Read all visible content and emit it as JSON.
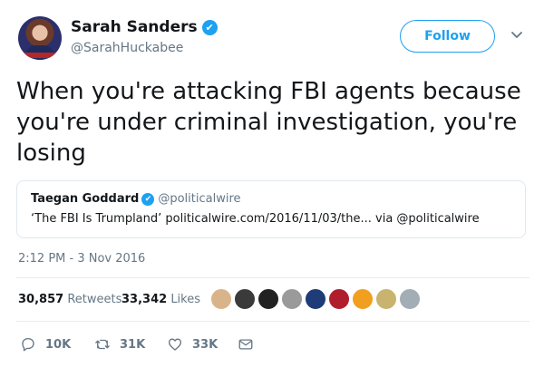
{
  "author": {
    "name": "Sarah Sanders",
    "handle": "@SarahHuckabee",
    "verified_glyph": "✔"
  },
  "follow_button": {
    "label": "Follow"
  },
  "tweet": {
    "text": "When you're attacking FBI agents because you're under criminal investigation, you're losing"
  },
  "quoted_tweet": {
    "author_name": "Taegan Goddard",
    "author_handle": "@politicalwire",
    "text": "‘The FBI Is Trumpland’ politicalwire.com/2016/11/03/the... via @politicalwire"
  },
  "timestamp": "2:12 PM - 3 Nov 2016",
  "stats": {
    "retweets_count": "30,857",
    "retweets_label": "Retweets",
    "likes_count": "33,342",
    "likes_label": "Likes",
    "liker_avatar_colors": [
      "#d9b48a",
      "#3a3a3a",
      "#222222",
      "#9a9a9a",
      "#1d3c78",
      "#b01e2d",
      "#f0a01e",
      "#c8b46e",
      "#a3adb5"
    ]
  },
  "actions": {
    "reply": {
      "icon": "reply-icon",
      "count": "10K"
    },
    "retweet": {
      "icon": "retweet-icon",
      "count": "31K"
    },
    "like": {
      "icon": "heart-icon",
      "count": "33K"
    },
    "message": {
      "icon": "envelope-icon"
    }
  },
  "colors": {
    "accent": "#1da1f2",
    "text": "#14171a",
    "secondary_text": "#657786",
    "border": "#e1e8ed"
  }
}
